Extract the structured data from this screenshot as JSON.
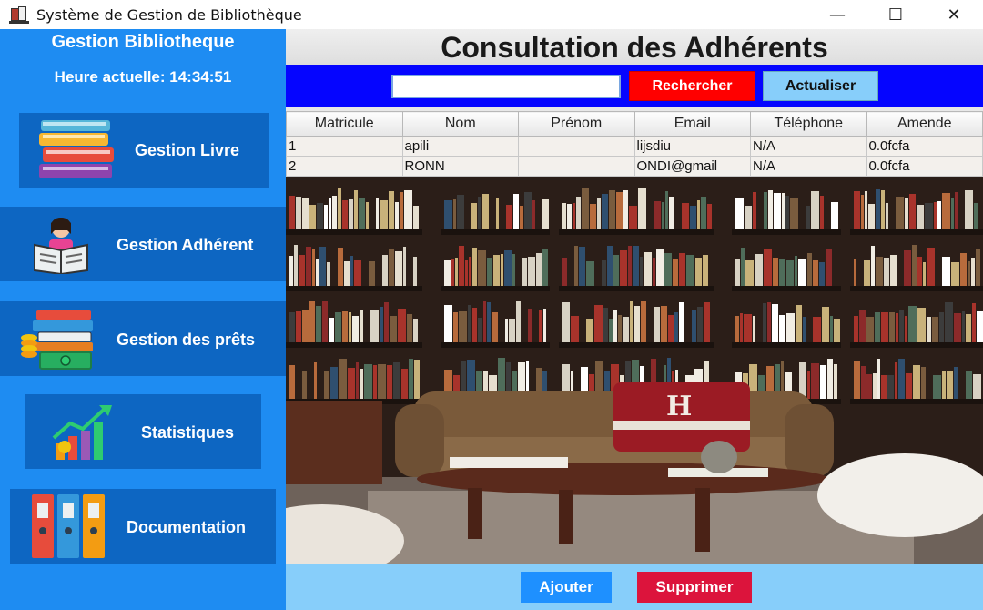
{
  "window": {
    "title": "Système de Gestion de Bibliothèque",
    "minimize_glyph": "—",
    "maximize_glyph": "☐",
    "close_glyph": "✕"
  },
  "sidebar": {
    "title": "Gestion Bibliotheque",
    "clock": "Heure actuelle: 14:34:51",
    "items": [
      {
        "label": "Gestion Livre",
        "icon": "books-stack-icon"
      },
      {
        "label": "Gestion Adhérent",
        "icon": "reader-icon"
      },
      {
        "label": "Gestion des prêts",
        "icon": "books-money-icon"
      },
      {
        "label": "Statistiques",
        "icon": "growth-chart-icon"
      },
      {
        "label": "Documentation",
        "icon": "binders-icon"
      }
    ]
  },
  "main": {
    "title": "Consultation des Adhérents",
    "search": {
      "value": "",
      "placeholder": ""
    },
    "search_button": "Rechercher",
    "refresh_button": "Actualiser",
    "table": {
      "columns": [
        "Matricule",
        "Nom",
        "Prénom",
        "Email",
        "Téléphone",
        "Amende"
      ],
      "rows": [
        [
          "1",
          "apili",
          "",
          "lijsdiu",
          "N/A",
          "0.0fcfa"
        ],
        [
          "2",
          "RONN",
          "",
          "ONDI@gmail",
          "N/A",
          "0.0fcfa"
        ]
      ]
    },
    "add_button": "Ajouter",
    "delete_button": "Supprimer"
  },
  "colors": {
    "sidebar": "#1e8cf2",
    "sidebar_button": "#0d66c2",
    "search_bar": "#0505ff",
    "search_button": "#ff0000",
    "refresh_button": "#87cefa",
    "add_button": "#1e90ff",
    "delete_button": "#dc143c",
    "bottom_bar": "#87cefa"
  }
}
